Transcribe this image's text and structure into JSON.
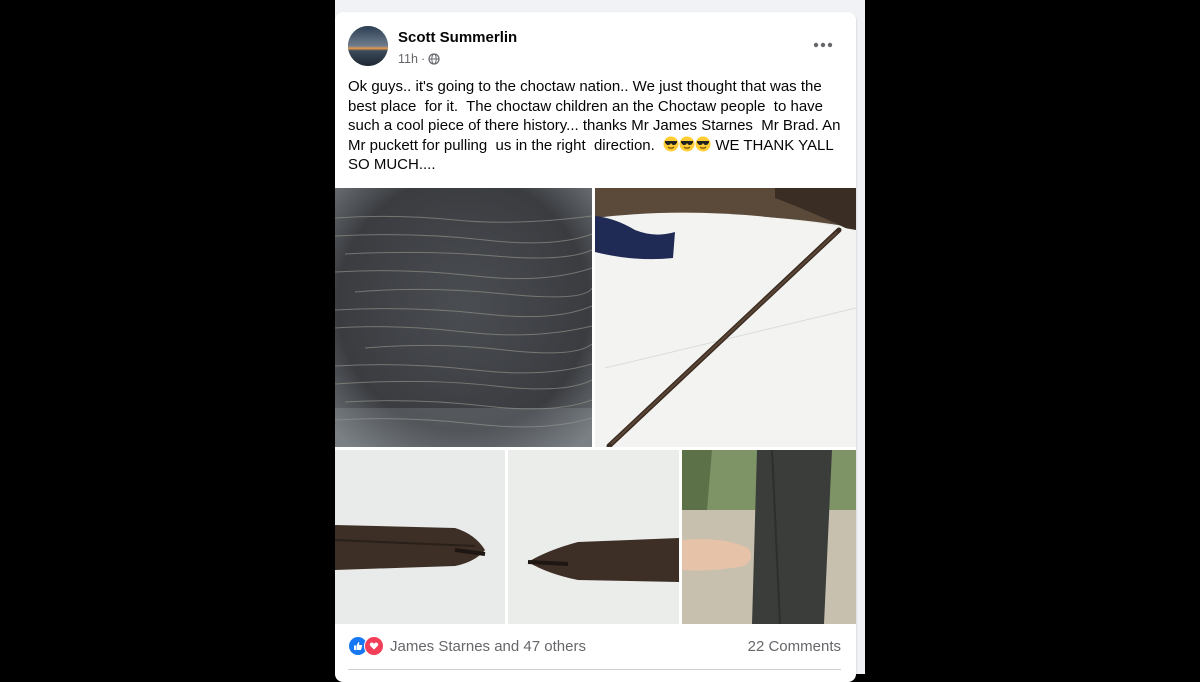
{
  "post": {
    "author": "Scott Summerlin",
    "time": "11h",
    "separator": "·",
    "audience_icon": "globe-icon",
    "more_icon": "more-dots-icon",
    "text_main": "Ok guys.. it's going to the choctaw nation.. We just thought that was the best place  for it.  The choctaw children an the Choctaw people  to have such a cool piece of there history... thanks Mr James Starnes  Mr Brad. An Mr puckett for pulling  us in the right  direction.  ",
    "text_emojis": "sunglasses-emoji ×3",
    "text_end": " WE THANK YALL SO MUCH....",
    "photos": [
      "wood-grain-closeup",
      "bow-on-white-car-hood",
      "bow-tip-left",
      "bow-tip-right",
      "finger-next-to-bow"
    ]
  },
  "reactions": {
    "icons": [
      "like-icon",
      "love-icon"
    ],
    "reactors": "James Starnes and 47 others",
    "comments": "22 Comments"
  },
  "colors": {
    "like": "#1877f2",
    "love": "#f33e58",
    "secondary_text": "#65676b",
    "feed_bg": "#f0f2f5"
  }
}
